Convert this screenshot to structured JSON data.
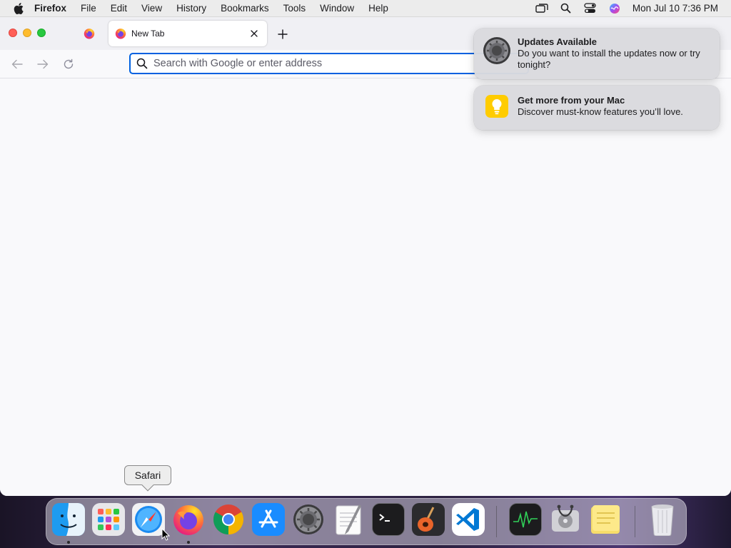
{
  "menubar": {
    "apple_icon": "apple-logo-icon",
    "app_name": "Firefox",
    "menus": [
      "File",
      "Edit",
      "View",
      "History",
      "Bookmarks",
      "Tools",
      "Window",
      "Help"
    ],
    "status_icons": [
      "screen-mirroring-icon",
      "spotlight-search-icon",
      "control-center-icon",
      "siri-icon"
    ],
    "clock": "Mon Jul 10  7:36 PM"
  },
  "browser": {
    "pinned_tab_icon": "firefox-icon",
    "active_tab": {
      "title": "New Tab",
      "favicon": "firefox-icon"
    },
    "new_tab_icon": "plus-icon",
    "nav": {
      "back_icon": "arrow-left-icon",
      "forward_icon": "arrow-right-icon",
      "reload_icon": "reload-icon"
    },
    "urlbar": {
      "placeholder": "Search with Google or enter address",
      "value": ""
    }
  },
  "notifications": [
    {
      "app_icon": "system-preferences-icon",
      "title": "Updates Available",
      "body": "Do you want to install the updates now or try tonight?"
    },
    {
      "app_icon": "tips-icon",
      "title": "Get more from your Mac",
      "body": "Discover must-know features you’ll love."
    }
  ],
  "dock": {
    "tooltip": "Safari",
    "apps": [
      {
        "name": "Finder",
        "icon": "finder-icon",
        "running": true
      },
      {
        "name": "Launchpad",
        "icon": "launchpad-icon",
        "running": false
      },
      {
        "name": "Safari",
        "icon": "safari-icon",
        "running": false
      },
      {
        "name": "Firefox",
        "icon": "firefox-icon",
        "running": true
      },
      {
        "name": "Google Chrome",
        "icon": "chrome-icon",
        "running": false
      },
      {
        "name": "App Store",
        "icon": "app-store-icon",
        "running": false
      },
      {
        "name": "System Preferences",
        "icon": "system-preferences-icon",
        "running": false
      },
      {
        "name": "TextEdit",
        "icon": "textedit-icon",
        "running": false
      },
      {
        "name": "Terminal",
        "icon": "terminal-icon",
        "running": false
      },
      {
        "name": "GarageBand",
        "icon": "garageband-icon",
        "running": false
      },
      {
        "name": "Visual Studio Code",
        "icon": "vscode-icon",
        "running": false
      },
      {
        "name": "Activity Monitor",
        "icon": "activity-monitor-icon",
        "running": false
      },
      {
        "name": "Disk Utility",
        "icon": "disk-utility-icon",
        "running": false
      },
      {
        "name": "Stickies",
        "icon": "stickies-icon",
        "running": false
      },
      {
        "name": "Trash",
        "icon": "trash-icon",
        "running": false
      }
    ]
  },
  "colors": {
    "accent": "#0061e0",
    "tab_strip": "#f0f0f4",
    "content_bg": "#f9f9fb",
    "traffic_close": "#ff5f57",
    "traffic_minimize": "#febc2e",
    "traffic_maximize": "#28c840"
  }
}
